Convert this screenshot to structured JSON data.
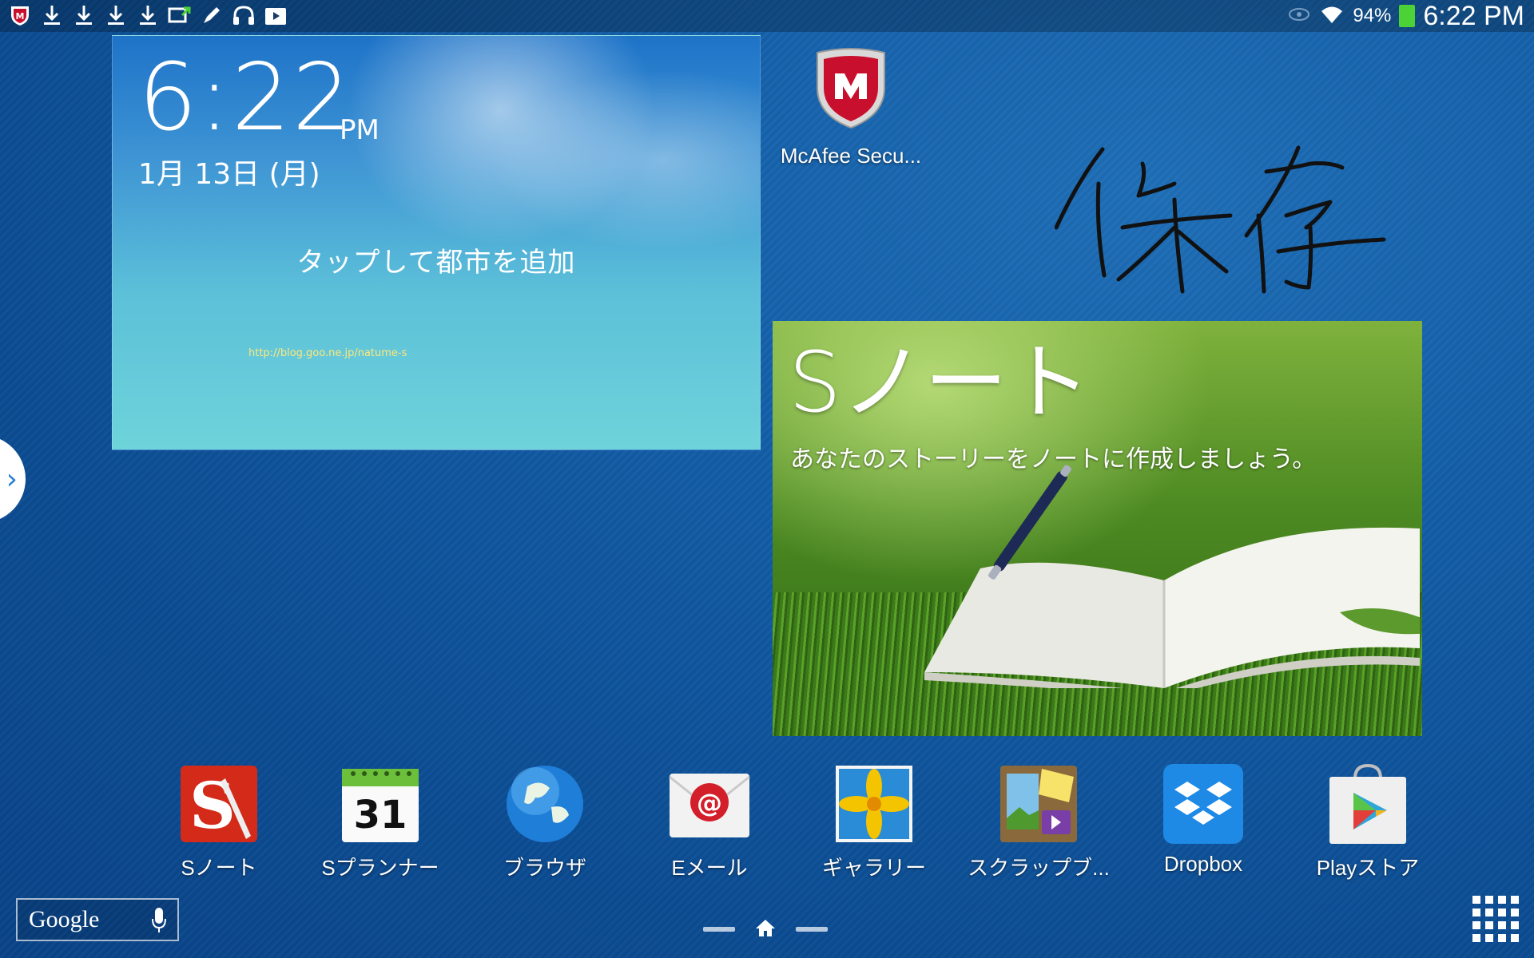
{
  "status_bar": {
    "battery_percent": "94%",
    "time": "6:22 PM",
    "notification_icons": [
      "mcafee-icon",
      "download-icon",
      "download-icon",
      "download-icon",
      "download-icon",
      "screen-share-icon",
      "pen-icon",
      "headphones-icon",
      "media-icon"
    ],
    "status_icons": [
      "eye-icon",
      "wifi-icon",
      "battery-icon"
    ]
  },
  "clock_widget": {
    "time": "6:22",
    "ampm": "PM",
    "date": "1月 13日 (月)",
    "add_city": "タップして都市を追加",
    "url": "http://blog.goo.ne.jp/natume-s"
  },
  "mcafee_app": {
    "label": "McAfee Secu..."
  },
  "handwritten_note": "保存",
  "snote_widget": {
    "title": "Sノート",
    "subtitle": "あなたのストーリーをノートに作成しましょう。"
  },
  "dock": {
    "apps": [
      {
        "label": "Sノート",
        "icon": "snote-icon"
      },
      {
        "label": "Sプランナー",
        "icon": "calendar-icon",
        "day": "31"
      },
      {
        "label": "ブラウザ",
        "icon": "globe-icon"
      },
      {
        "label": "Eメール",
        "icon": "email-icon"
      },
      {
        "label": "ギャラリー",
        "icon": "gallery-icon"
      },
      {
        "label": "スクラップブ...",
        "icon": "scrapbook-icon"
      },
      {
        "label": "Dropbox",
        "icon": "dropbox-icon"
      },
      {
        "label": "Playストア",
        "icon": "play-store-icon"
      }
    ]
  },
  "google_search": {
    "label": "Google"
  },
  "colors": {
    "accent": "#135ea8",
    "battery": "#4cd137"
  }
}
